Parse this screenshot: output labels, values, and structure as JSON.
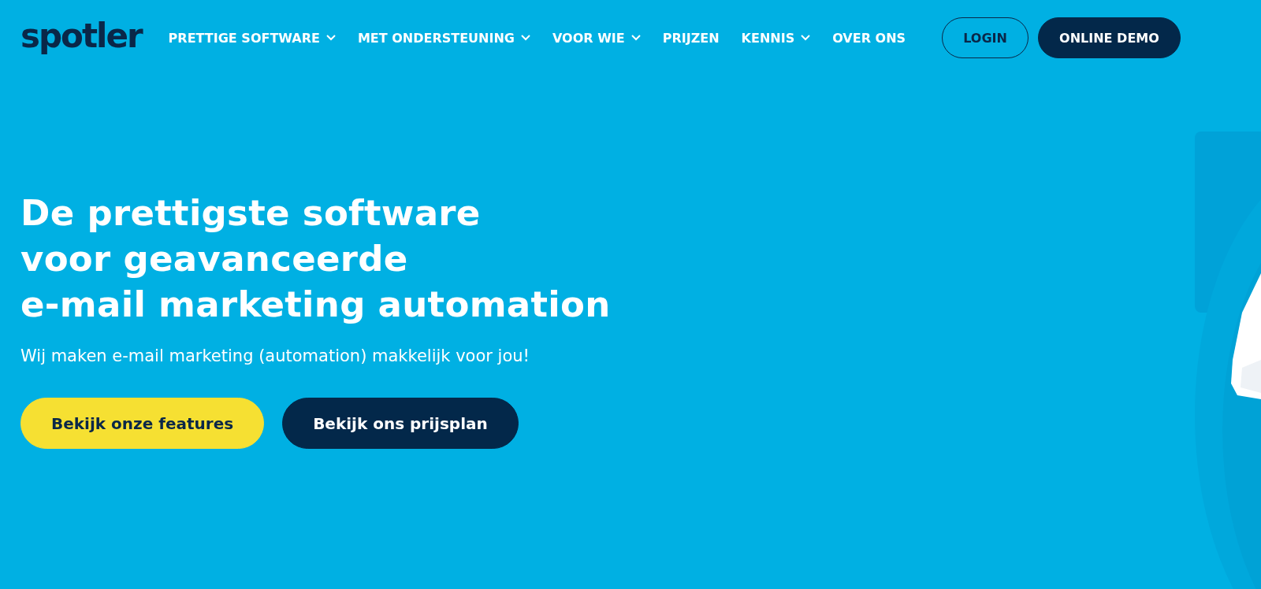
{
  "header": {
    "logo": "spotler",
    "nav": [
      {
        "label": "PRETTIGE SOFTWARE",
        "has_dropdown": true
      },
      {
        "label": "MET ONDERSTEUNING",
        "has_dropdown": true
      },
      {
        "label": "VOOR WIE",
        "has_dropdown": true
      },
      {
        "label": "PRIJZEN",
        "has_dropdown": false
      },
      {
        "label": "KENNIS",
        "has_dropdown": true
      },
      {
        "label": "OVER ONS",
        "has_dropdown": false
      }
    ],
    "actions": [
      {
        "label": "LOGIN",
        "kind": "outline"
      },
      {
        "label": "ONLINE DEMO",
        "kind": "dark"
      }
    ]
  },
  "hero": {
    "title_lines": [
      "De prettigste software",
      "voor geavanceerde",
      "e-mail marketing automation"
    ],
    "subtitle": "Wij maken e-mail marketing (automation) makkelijk voor jou!",
    "buttons": [
      {
        "label": "Bekijk onze features",
        "kind": "yellow"
      },
      {
        "label": "Bekijk ons prijsplan",
        "kind": "dark"
      }
    ]
  }
}
